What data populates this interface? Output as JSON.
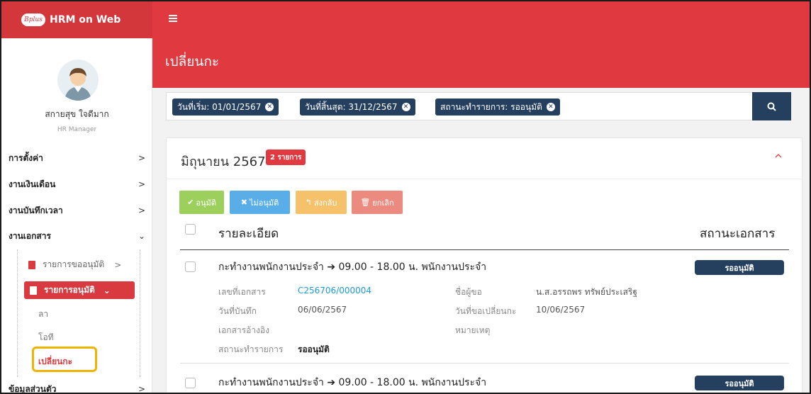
{
  "app": {
    "name": "HRM on Web",
    "logo_text": "Bplus"
  },
  "user": {
    "name": "สกายสุข ใจดีมาก",
    "role": "HR Manager"
  },
  "page": {
    "title": "เปลี่ยนกะ"
  },
  "menu": [
    {
      "label": "การตั้งค่า",
      "chevron": ">"
    },
    {
      "label": "งานเงินเดือน",
      "chevron": ">"
    },
    {
      "label": "งานบันทึกเวลา",
      "chevron": ">"
    },
    {
      "label": "งานเอกสาร",
      "chevron": "⌄"
    },
    {
      "label": "ข้อมูลส่วนตัว",
      "chevron": ">"
    }
  ],
  "submenu": {
    "pending": {
      "label": "รายการขออนุมัติ",
      "chevron": ">"
    },
    "approved": {
      "label": "รายการอนุมัติ",
      "chevron": "⌄"
    },
    "items": [
      "ลา",
      "โอที",
      "เปลี่ยนกะ"
    ]
  },
  "filters": [
    {
      "label": "วันที่เริ่ม: 01/01/2567"
    },
    {
      "label": "วันที่สิ้นสุด: 31/12/2567"
    },
    {
      "label": "สถานะทำรายการ: รออนุมัติ"
    }
  ],
  "group": {
    "month": "มิถุนายน 2567",
    "count": "2 รายการ"
  },
  "actions": {
    "approve": "อนุมัติ",
    "reject": "ไม่อนุมัติ",
    "return": "ส่งกลับ",
    "cancel": "ยกเลิก"
  },
  "table": {
    "col_detail": "รายละเอียด",
    "col_status": "สถานะเอกสาร"
  },
  "rows": [
    {
      "title": "กะทำงานพนักงานประจำ ➔ 09.00 - 18.00 น. พนักงานประจำ",
      "status": "รออนุมัติ",
      "fields": {
        "doc_no_label": "เลขที่เอกสาร",
        "doc_no": "C256706/000004",
        "requester_label": "ชื่อผู้ขอ",
        "requester": "น.ส.อรรถพร ทรัพย์ประเสริฐ",
        "record_date_label": "วันที่บันทึก",
        "record_date": "06/06/2567",
        "change_date_label": "วันที่ขอเปลี่ยนกะ",
        "change_date": "10/06/2567",
        "ref_label": "เอกสารอ้างอิง",
        "note_label": "หมายเหตุ",
        "state_label": "สถานะทำรายการ",
        "state": "รออนุมัติ"
      }
    },
    {
      "title": "กะทำงานพนักงานประจำ ➔ 09.00 - 18.00 น. พนักงานประจำ",
      "status": "รออนุมัติ"
    }
  ],
  "colors": {
    "brand_red": "#e0393f",
    "navy": "#253f5e",
    "approve": "#9ccf5c",
    "reject": "#5aaee8",
    "return": "#f5c26b",
    "cancel": "#eb8a7f",
    "highlight": "#f0b400"
  },
  "icons": {
    "menu": "hamburger-icon",
    "search": "search-icon",
    "doc": "document-icon"
  }
}
